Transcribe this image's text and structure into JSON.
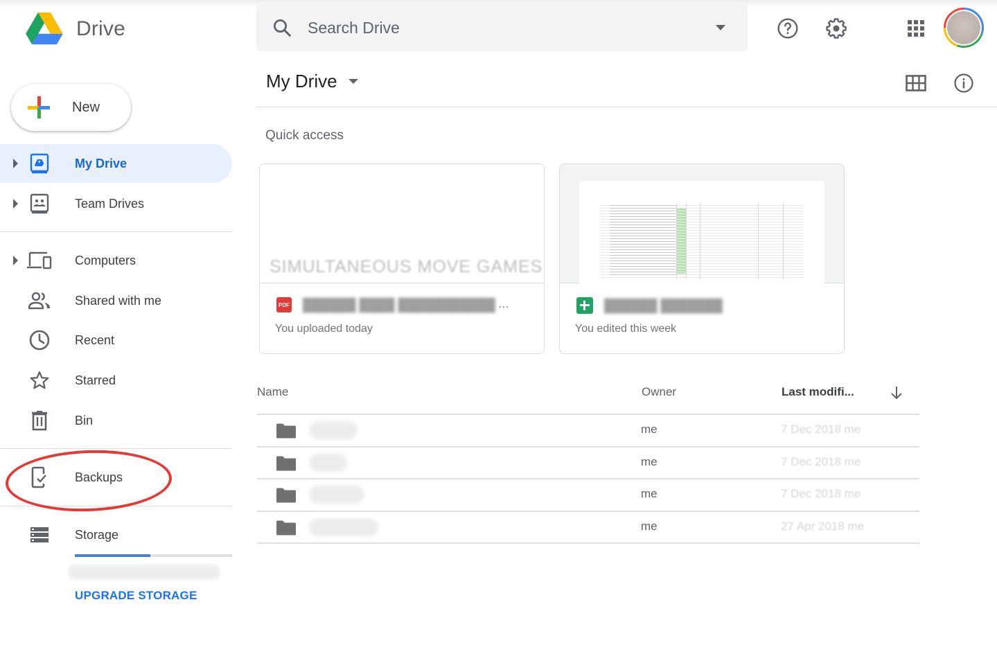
{
  "app": {
    "name": "Drive"
  },
  "search": {
    "placeholder": "Search Drive"
  },
  "header_icons": {
    "help": "help-icon",
    "settings": "settings-icon",
    "apps": "apps-grid-icon",
    "account": "account-avatar"
  },
  "new_button": {
    "label": "New"
  },
  "sidebar": {
    "items": [
      {
        "label": "My Drive",
        "icon": "my-drive-icon",
        "expandable": true,
        "active": true
      },
      {
        "label": "Team Drives",
        "icon": "team-drives-icon",
        "expandable": true
      },
      {
        "label": "Computers",
        "icon": "computers-icon",
        "expandable": true
      },
      {
        "label": "Shared with me",
        "icon": "shared-people-icon"
      },
      {
        "label": "Recent",
        "icon": "clock-icon"
      },
      {
        "label": "Starred",
        "icon": "star-icon"
      },
      {
        "label": "Bin",
        "icon": "trash-icon"
      },
      {
        "label": "Backups",
        "icon": "backup-device-icon",
        "annotated": true
      },
      {
        "label": "Storage",
        "icon": "storage-icon"
      }
    ],
    "storage": {
      "used_fraction": 0.48,
      "upgrade_label": "UPGRADE STORAGE"
    }
  },
  "main": {
    "title": "My Drive",
    "view_icons": {
      "grid": "grid-view-icon",
      "info": "info-icon"
    },
    "quick_access": {
      "title": "Quick access",
      "cards": [
        {
          "type": "PDF",
          "preview_text": "SIMULTANEOUS MOVE GAMES",
          "name": "[redacted] …",
          "meta": "You uploaded today"
        },
        {
          "type": "Sheets",
          "name": "[redacted]",
          "meta": "You edited this week"
        }
      ]
    },
    "file_list": {
      "columns": {
        "name": "Name",
        "owner": "Owner",
        "last_modified": "Last modifi..."
      },
      "sort": "descending",
      "rows": [
        {
          "type": "folder",
          "name": "[redacted]",
          "owner": "me",
          "last_modified": "7 Dec 2018 me"
        },
        {
          "type": "folder",
          "name": "[redacted]",
          "owner": "me",
          "last_modified": "7 Dec 2018 me"
        },
        {
          "type": "folder",
          "name": "[redacted]",
          "owner": "me",
          "last_modified": "7 Dec 2018 me"
        },
        {
          "type": "folder",
          "name": "[redacted]",
          "owner": "me",
          "last_modified": "27 Apr 2018 me"
        }
      ]
    }
  },
  "colors": {
    "accent_blue": "#1a73e8",
    "active_bg": "#e8f0fe",
    "annotation_red": "#e53935",
    "pdf_red": "#e53935",
    "sheets_green": "#1fa463"
  }
}
